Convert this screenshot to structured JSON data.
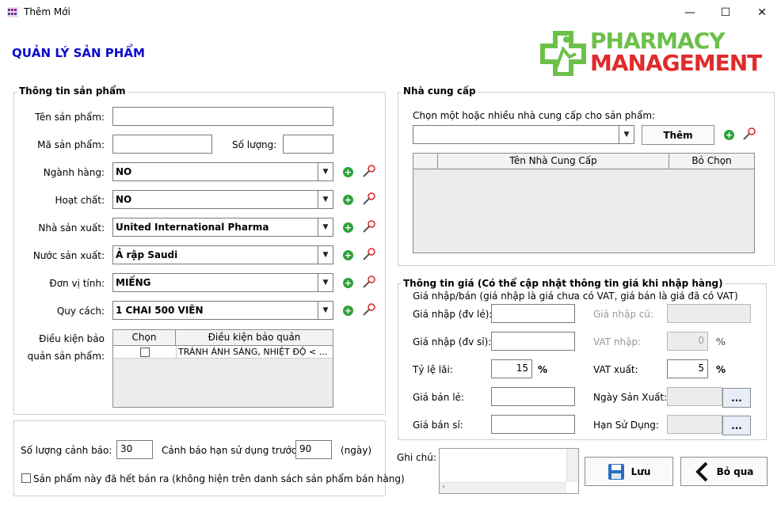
{
  "window": {
    "title": "Thêm Mới",
    "minimize": "—",
    "maximize": "☐",
    "close": "✕"
  },
  "page_title": "QUẢN LÝ SẢN PHẨM",
  "logo": {
    "line1": "PHARMACY",
    "line2": "MANAGEMENT"
  },
  "product_info": {
    "title": "Thông tin sản phẩm",
    "name_label": "Tên sản phẩm:",
    "name_value": "",
    "code_label": "Mã sản phẩm:",
    "code_value": "",
    "qty_label": "Số lượng:",
    "qty_value": "",
    "category_label": "Ngành hàng:",
    "category_value": "NO",
    "ingredient_label": "Hoạt chất:",
    "ingredient_value": "NO",
    "manufacturer_label": "Nhà sản xuất:",
    "manufacturer_value": "United International Pharma",
    "country_label": "Nước sản xuất:",
    "country_value": "Ả rập Saudi",
    "unit_label": "Đơn vị tính:",
    "unit_value": "MIẾNG",
    "packing_label": "Quy cách:",
    "packing_value": "1 CHAI 500 VIÊN",
    "storage_label_1": "Điều kiện bảo",
    "storage_label_2": "quản sản phẩm:",
    "storage_table": {
      "col_select": "Chọn",
      "col_condition": "Điều kiện bảo quản",
      "rows": [
        {
          "checked": false,
          "condition": "TRÁNH ÁNH SÁNG, NHIỆT ĐỘ < ..."
        }
      ]
    }
  },
  "warning": {
    "qty_warning_label": "Số lượng cảnh báo:",
    "qty_warning_value": "30",
    "expiry_warning_label": "Cảnh báo hạn sử dụng trước:",
    "expiry_warning_value": "90",
    "expiry_unit": "(ngày)",
    "discontinued_label": "Sản phẩm này đã hết bán ra (không hiện trên danh sách sản phẩm bán hàng)",
    "discontinued_checked": false
  },
  "supplier": {
    "title": "Nhà cung cấp",
    "prompt": "Chọn một hoặc nhiều nhà cung cấp cho sản phẩm:",
    "selected": "",
    "add_button": "Thêm",
    "table": {
      "col_name": "Tên Nhà Cung Cấp",
      "col_remove": "Bỏ Chọn"
    }
  },
  "price": {
    "title": "Thông tin giá (Có thể cập nhật thông tin giá khi nhập hàng)",
    "note": "Giá nhập/bán (giá nhập là giá chưa có VAT, giá bán là giá đã có VAT)",
    "import_retail_label": "Giá nhập (đv lẻ):",
    "import_retail_value": "",
    "import_wholesale_label": "Giá nhập (đv sỉ):",
    "import_wholesale_value": "",
    "margin_label": "Tỷ lệ lãi:",
    "margin_value": "15",
    "margin_unit": "%",
    "sell_retail_label": "Giá bán lẻ:",
    "sell_retail_value": "",
    "sell_wholesale_label": "Giá bán sỉ:",
    "sell_wholesale_value": "",
    "old_import_label": "Giá nhập cũ:",
    "old_import_value": "",
    "vat_in_label": "VAT nhập:",
    "vat_in_value": "0",
    "vat_in_unit": "%",
    "vat_out_label": "VAT xuất:",
    "vat_out_value": "5",
    "vat_out_unit": "%",
    "mfg_date_label": "Ngày Sản Xuất:",
    "mfg_date_value": "",
    "expiry_label": "Hạn Sử Dụng:",
    "expiry_value": "",
    "date_button": "..."
  },
  "note": {
    "label": "Ghi chú:",
    "value": ""
  },
  "actions": {
    "save": "Lưu",
    "skip": "Bỏ qua"
  }
}
